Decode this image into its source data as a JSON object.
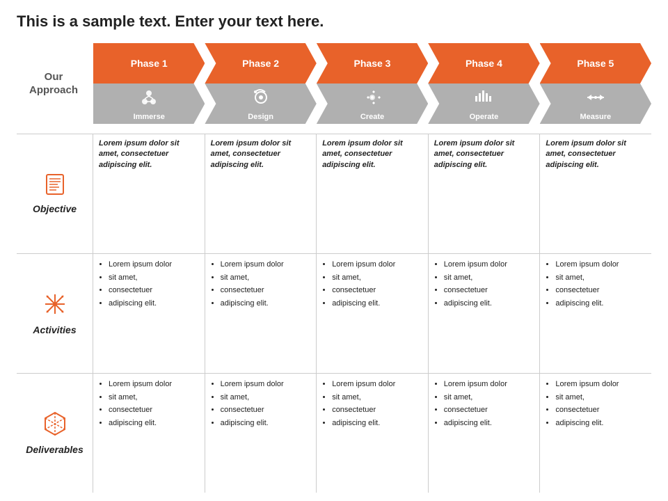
{
  "title": "This is a sample text. Enter your text here.",
  "approach_label": "Our\nApproach",
  "phases": [
    {
      "id": 1,
      "name": "Phase 1",
      "sub": "Immerse",
      "icon": "⊛"
    },
    {
      "id": 2,
      "name": "Phase 2",
      "sub": "Design",
      "icon": "🎨"
    },
    {
      "id": 3,
      "name": "Phase 3",
      "sub": "Create",
      "icon": "⚙"
    },
    {
      "id": 4,
      "name": "Phase 4",
      "sub": "Operate",
      "icon": "📊"
    },
    {
      "id": 5,
      "name": "Phase 5",
      "sub": "Measure",
      "icon": "↔"
    }
  ],
  "rows": [
    {
      "label": "Objective",
      "icon_type": "objective",
      "cells": [
        "Lorem ipsum dolor sit amet, consectetuer adipiscing elit.",
        "Lorem ipsum dolor sit amet, consectetuer adipiscing elit.",
        "Lorem ipsum dolor sit amet, consectetuer adipiscing elit.",
        "Lorem ipsum dolor sit amet, consectetuer adipiscing elit.",
        "Lorem ipsum dolor sit amet, consectetuer adipiscing elit."
      ],
      "cell_style": "italic-bold"
    },
    {
      "label": "Activities",
      "icon_type": "activities",
      "cells": [
        [
          "Lorem ipsum dolor",
          "sit amet,",
          "consectetuer",
          "adipiscing elit."
        ],
        [
          "Lorem ipsum dolor",
          "sit amet,",
          "consectetuer",
          "adipiscing elit."
        ],
        [
          "Lorem ipsum dolor",
          "sit amet,",
          "consectetuer",
          "adipiscing elit."
        ],
        [
          "Lorem ipsum dolor",
          "sit amet,",
          "consectetuer",
          "adipiscing elit."
        ],
        [
          "Lorem ipsum dolor",
          "sit amet,",
          "consectetuer",
          "adipiscing elit."
        ]
      ],
      "cell_style": "bullet"
    },
    {
      "label": "Deliverables",
      "icon_type": "deliverables",
      "cells": [
        [
          "Lorem ipsum dolor",
          "sit amet,",
          "consectetuer",
          "adipiscing elit."
        ],
        [
          "Lorem ipsum dolor",
          "sit amet,",
          "consectetuer",
          "adipiscing elit."
        ],
        [
          "Lorem ipsum dolor",
          "sit amet,",
          "consectetuer",
          "adipiscing elit."
        ],
        [
          "Lorem ipsum dolor",
          "sit amet,",
          "consectetuer",
          "adipiscing elit."
        ],
        [
          "Lorem ipsum dolor",
          "sit amet,",
          "consectetuer",
          "adipiscing elit."
        ]
      ],
      "cell_style": "bullet"
    }
  ]
}
